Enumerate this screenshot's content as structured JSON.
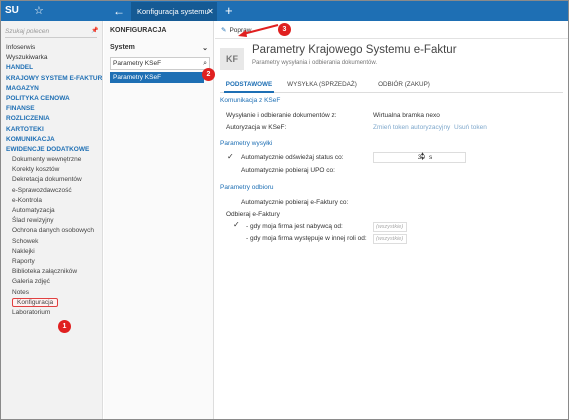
{
  "topbar": {
    "logo": "SU",
    "tab_label": "Konfiguracja systemu",
    "tab_close": "✕",
    "plus": "+"
  },
  "leftnav": {
    "search_placeholder": "Szukaj polecen",
    "items": [
      {
        "label": "Infoserwis",
        "type": "plain"
      },
      {
        "label": "Wyszukiwarka",
        "type": "plain"
      },
      {
        "label": "HANDEL",
        "type": "head"
      },
      {
        "label": "KRAJOWY SYSTEM E-FAKTUR",
        "type": "head"
      },
      {
        "label": "MAGAZYN",
        "type": "head"
      },
      {
        "label": "POLITYKA CENOWA",
        "type": "head"
      },
      {
        "label": "FINANSE",
        "type": "head"
      },
      {
        "label": "ROZLICZENIA",
        "type": "head"
      },
      {
        "label": "KARTOTEKI",
        "type": "head"
      },
      {
        "label": "KOMUNIKACJA",
        "type": "head"
      },
      {
        "label": "EWIDENCJE DODATKOWE",
        "type": "head"
      },
      {
        "label": "Dokumenty wewnętrzne",
        "type": "sub"
      },
      {
        "label": "Korekty kosztów",
        "type": "sub"
      },
      {
        "label": "Dekretacja dokumentów",
        "type": "sub"
      },
      {
        "label": "e-Sprawozdawczość",
        "type": "sub"
      },
      {
        "label": "e-Kontrola",
        "type": "sub"
      },
      {
        "label": "Automatyzacja",
        "type": "sub"
      },
      {
        "label": "Ślad rewizyjny",
        "type": "sub"
      },
      {
        "label": "Ochrona danych osobowych",
        "type": "sub"
      },
      {
        "label": "Schowek",
        "type": "sub"
      },
      {
        "label": "Naklejki",
        "type": "sub"
      },
      {
        "label": "Raporty",
        "type": "sub"
      },
      {
        "label": "Biblioteka załączników",
        "type": "sub"
      },
      {
        "label": "Galeria zdjęć",
        "type": "sub"
      },
      {
        "label": "Notes",
        "type": "sub"
      },
      {
        "label": "Konfiguracja",
        "type": "sub-hl"
      },
      {
        "label": "Laboratorium",
        "type": "sub"
      }
    ]
  },
  "config": {
    "title": "KONFIGURACJA",
    "select_value": "System",
    "search_value": "Parametry KSeF",
    "selected_item": "Parametry KSeF"
  },
  "main": {
    "edit_label": "Popraw",
    "icon_text": "KF",
    "title": "Parametry Krajowego Systemu e-Faktur",
    "subtitle": "Parametry wysyłania i odbierania dokumentów.",
    "tabs": [
      "PODSTAWOWE",
      "WYSYŁKA (SPRZEDAŻ)",
      "ODBIÓR (ZAKUP)"
    ],
    "sec_ksef": "Komunikacja z KSeF",
    "send_receive_label": "Wysyłanie i odbieranie dokumentów z:",
    "send_receive_value": "Wirtualna bramka nexo",
    "auth_label": "Autoryzacja w KSeF:",
    "auth_link1": "Zmień token autoryzacyjny",
    "auth_link2": "Usuń token",
    "sec_send": "Parametry wysyłki",
    "auto_status_label": "Automatycznie odświeżaj status co:",
    "auto_status_value": "30",
    "auto_status_unit": "s",
    "auto_upo_label": "Automatycznie pobieraj UPO co:",
    "sec_receive": "Parametry odbioru",
    "auto_fetch_label": "Automatycznie pobieraj e-Faktury co:",
    "receive_label": "Odbieraj e-Faktury",
    "buyer_label": "- gdy moja firma jest nabywcą od:",
    "other_role_label": "- gdy moja firma występuje w innej roli od:",
    "placeholder_all": "(wszystkie)"
  },
  "markers": [
    "1",
    "2",
    "3"
  ],
  "colors": {
    "accent": "#1e6fb4",
    "marker": "#e02020"
  }
}
